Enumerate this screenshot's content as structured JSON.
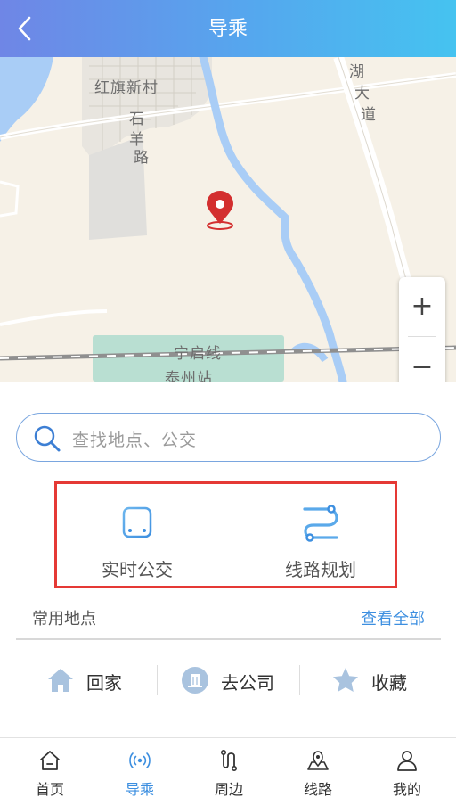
{
  "header": {
    "title": "导乘"
  },
  "map": {
    "labels": {
      "village": "红旗新村",
      "road_shi": "石",
      "road_yang": "羊",
      "road_lu": "路",
      "lake": "湖",
      "avenue_da": "大",
      "avenue_dao": "道",
      "rail_line": "宁启线",
      "station": "泰州站"
    },
    "zoom_in": "+",
    "zoom_out": "−"
  },
  "search": {
    "placeholder": "查找地点、公交"
  },
  "features": {
    "realtime_bus": "实时公交",
    "route_plan": "线路规划"
  },
  "frequent": {
    "title": "常用地点",
    "view_all": "查看全部",
    "items": [
      {
        "label": "回家",
        "icon": "home-icon"
      },
      {
        "label": "去公司",
        "icon": "building-icon"
      },
      {
        "label": "收藏",
        "icon": "star-icon"
      }
    ]
  },
  "tabs": [
    {
      "label": "首页",
      "icon": "home-icon"
    },
    {
      "label": "导乘",
      "icon": "broadcast-icon",
      "active": true
    },
    {
      "label": "周边",
      "icon": "route-icon"
    },
    {
      "label": "线路",
      "icon": "map-pin-icon"
    },
    {
      "label": "我的",
      "icon": "user-icon"
    }
  ],
  "colors": {
    "accent": "#3d8fe0",
    "header_start": "#6f86e6",
    "header_end": "#45c3f0",
    "highlight_border": "#e53935",
    "pin": "#d32f2f"
  }
}
